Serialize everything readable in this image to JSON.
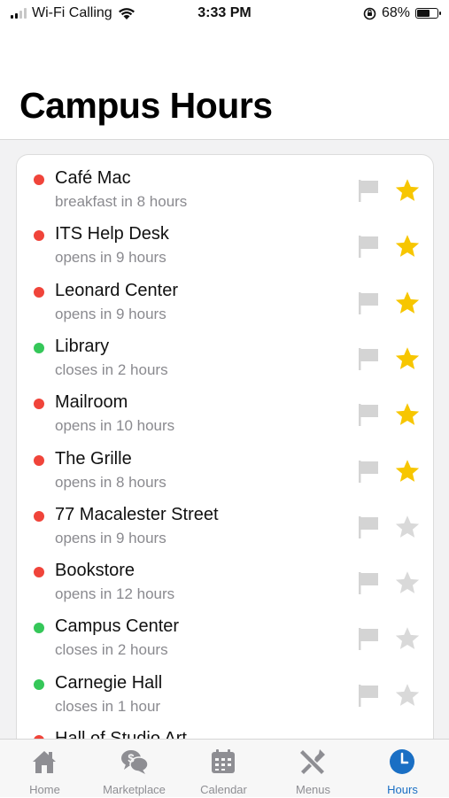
{
  "status_bar": {
    "carrier": "Wi-Fi Calling",
    "time": "3:33 PM",
    "battery_percent": "68%",
    "battery_level": 0.68
  },
  "page": {
    "title": "Campus Hours"
  },
  "locations": [
    {
      "name": "Café Mac",
      "status": "breakfast in 8 hours",
      "open": false,
      "favorite": true
    },
    {
      "name": "ITS Help Desk",
      "status": "opens in 9 hours",
      "open": false,
      "favorite": true
    },
    {
      "name": "Leonard Center",
      "status": "opens in 9 hours",
      "open": false,
      "favorite": true
    },
    {
      "name": "Library",
      "status": "closes in 2 hours",
      "open": true,
      "favorite": true
    },
    {
      "name": "Mailroom",
      "status": "opens in 10 hours",
      "open": false,
      "favorite": true
    },
    {
      "name": "The Grille",
      "status": "opens in 8 hours",
      "open": false,
      "favorite": true
    },
    {
      "name": "77 Macalester Street",
      "status": "opens in 9 hours",
      "open": false,
      "favorite": false
    },
    {
      "name": "Bookstore",
      "status": "opens in 12 hours",
      "open": false,
      "favorite": false
    },
    {
      "name": "Campus Center",
      "status": "closes in 2 hours",
      "open": true,
      "favorite": false
    },
    {
      "name": "Carnegie Hall",
      "status": "closes in 1 hour",
      "open": true,
      "favorite": false
    },
    {
      "name": "Hall of Studio Art",
      "status": "",
      "open": false,
      "favorite": false
    }
  ],
  "colors": {
    "closed_dot": "#f0443a",
    "open_dot": "#35c759",
    "star_active": "#f7c600",
    "star_inactive": "#d9d9d9",
    "flag": "#d4d4d4",
    "tab_active": "#1a6fc4",
    "tab_inactive": "#8e8e93"
  },
  "tabs": [
    {
      "label": "Home",
      "icon": "home-icon",
      "active": false
    },
    {
      "label": "Marketplace",
      "icon": "marketplace-icon",
      "active": false
    },
    {
      "label": "Calendar",
      "icon": "calendar-icon",
      "active": false
    },
    {
      "label": "Menus",
      "icon": "menus-icon",
      "active": false
    },
    {
      "label": "Hours",
      "icon": "clock-icon",
      "active": true
    }
  ]
}
